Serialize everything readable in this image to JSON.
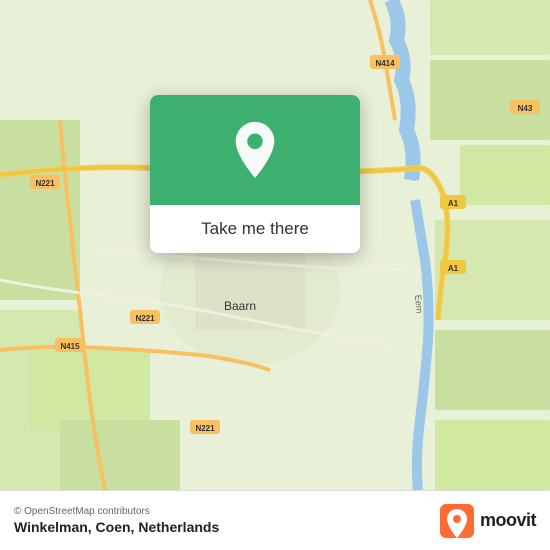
{
  "map": {
    "background_color": "#e8f0d8",
    "attribution": "© OpenStreetMap contributors"
  },
  "popup": {
    "button_label": "Take me there",
    "pin_color": "#fff"
  },
  "bottom_bar": {
    "attribution": "© OpenStreetMap contributors",
    "location_name": "Winkelman, Coen, Netherlands",
    "moovit_label": "moovit"
  }
}
